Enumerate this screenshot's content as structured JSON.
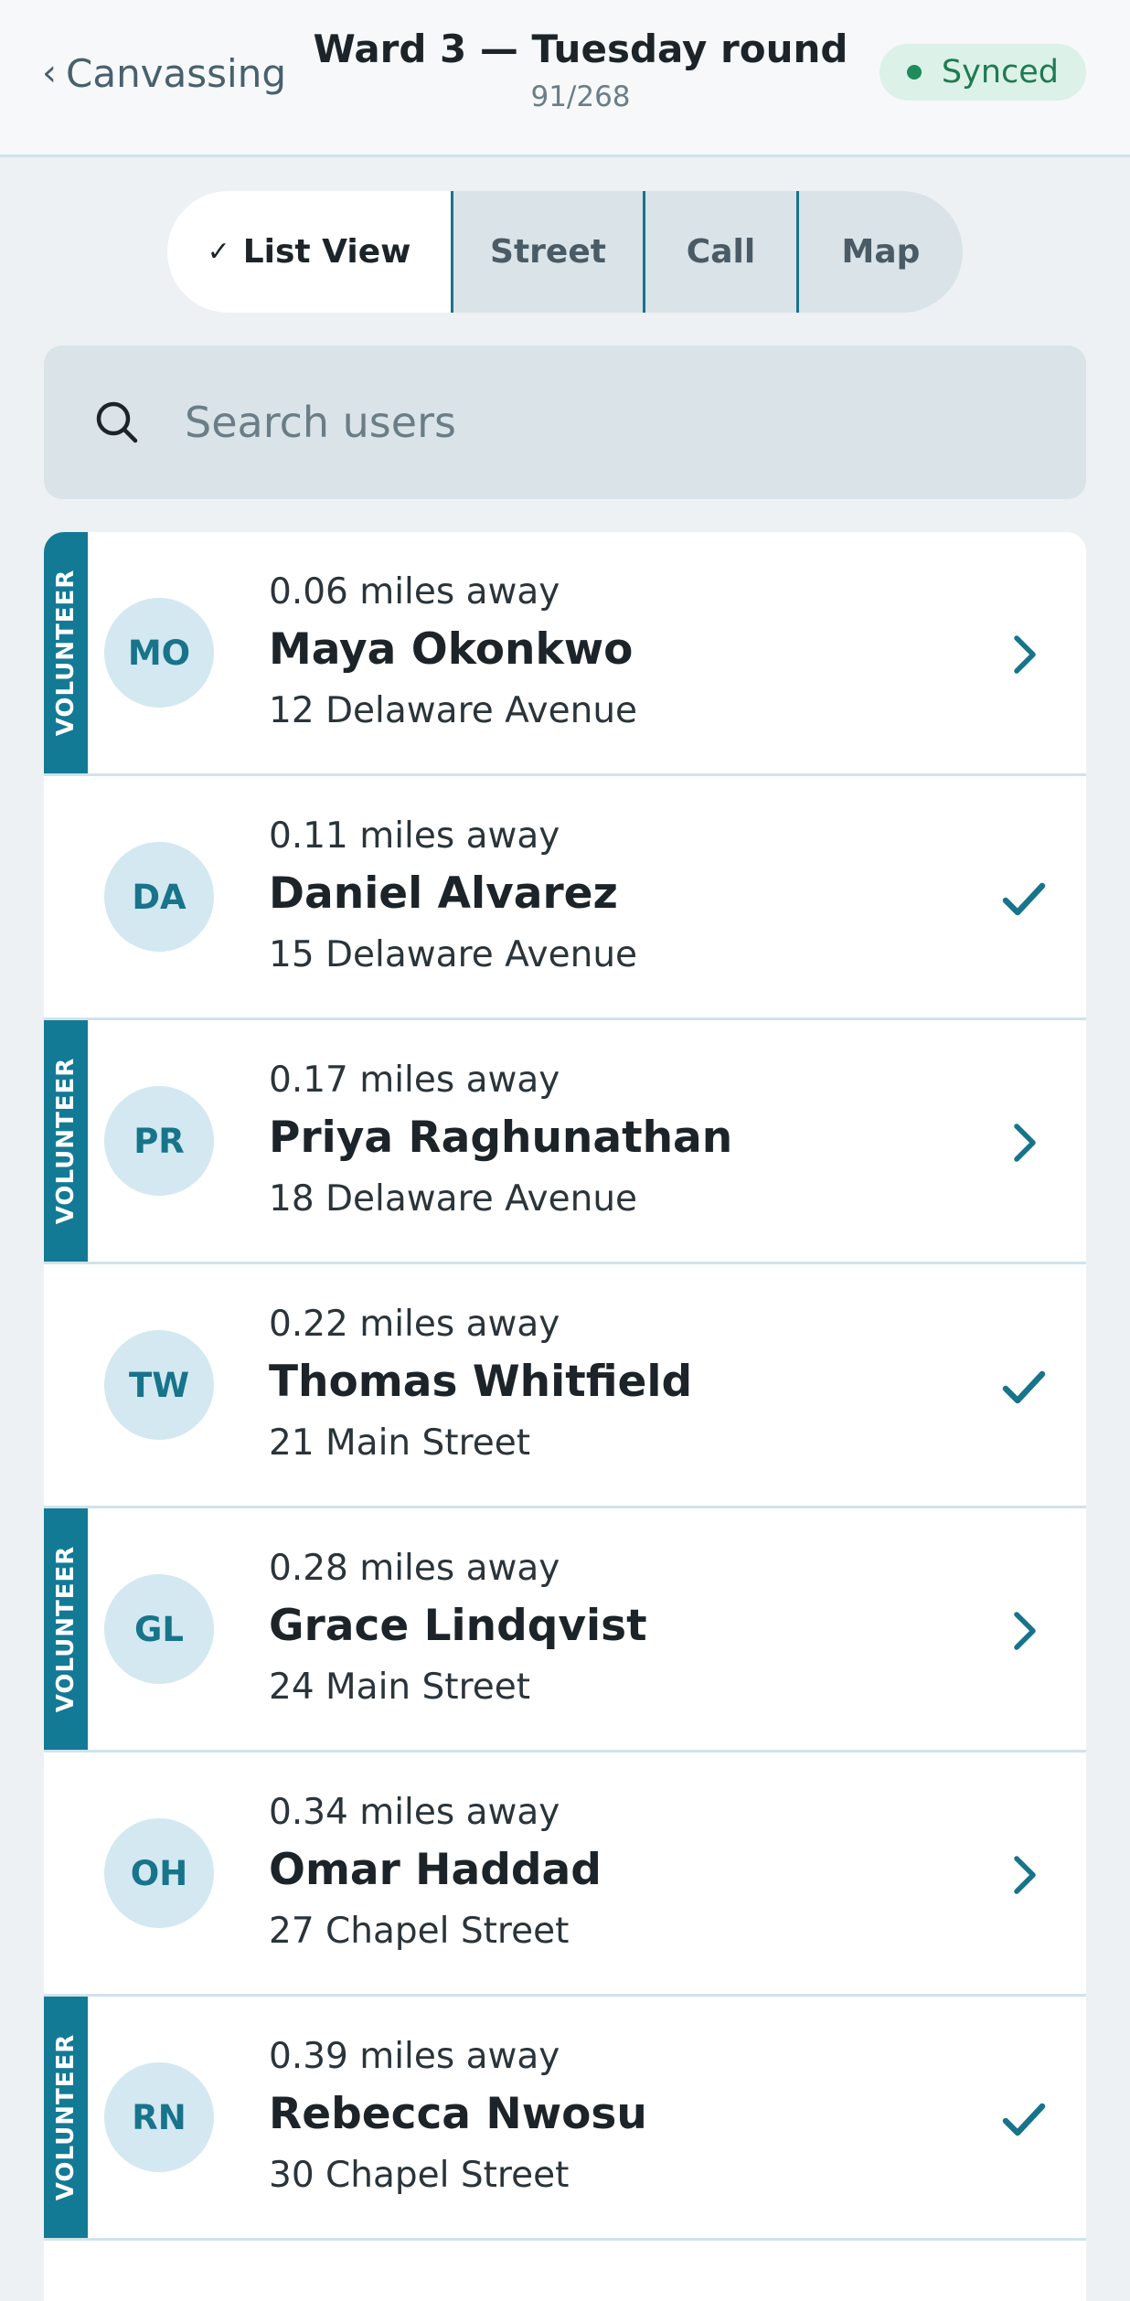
{
  "header": {
    "back_label": "Canvassing",
    "title": "Ward 3 — Tuesday round",
    "progress": "91/268",
    "sync_status": "Synced"
  },
  "view_tabs": {
    "active_check": "✓",
    "items": [
      "List View",
      "Street",
      "Call",
      "Map"
    ],
    "selected": "List View"
  },
  "search": {
    "placeholder": "Search users",
    "value": ""
  },
  "volunteer_tag": "VOLUNTEER",
  "colors": {
    "accent": "#137a95",
    "synced": "#1f7a52"
  },
  "contacts": [
    {
      "initials": "MO",
      "distance": "0.06 miles away",
      "name": "Maya Okonkwo",
      "address": "12 Delaware Avenue",
      "volunteer": true,
      "action": "chevron-right-icon"
    },
    {
      "initials": "DA",
      "distance": "0.11 miles away",
      "name": "Daniel Alvarez",
      "address": "15 Delaware Avenue",
      "volunteer": false,
      "action": "check-icon"
    },
    {
      "initials": "PR",
      "distance": "0.17 miles away",
      "name": "Priya Raghunathan",
      "address": "18 Delaware Avenue",
      "volunteer": true,
      "action": "chevron-right-icon"
    },
    {
      "initials": "TW",
      "distance": "0.22 miles away",
      "name": "Thomas Whitfield",
      "address": "21 Main Street",
      "volunteer": false,
      "action": "check-icon"
    },
    {
      "initials": "GL",
      "distance": "0.28 miles away",
      "name": "Grace Lindqvist",
      "address": "24 Main Street",
      "volunteer": true,
      "action": "chevron-right-icon"
    },
    {
      "initials": "OH",
      "distance": "0.34 miles away",
      "name": "Omar Haddad",
      "address": "27 Chapel Street",
      "volunteer": false,
      "action": "chevron-right-icon"
    },
    {
      "initials": "RN",
      "distance": "0.39 miles away",
      "name": "Rebecca Nwosu",
      "address": "30 Chapel Street",
      "volunteer": true,
      "action": "check-icon"
    }
  ]
}
